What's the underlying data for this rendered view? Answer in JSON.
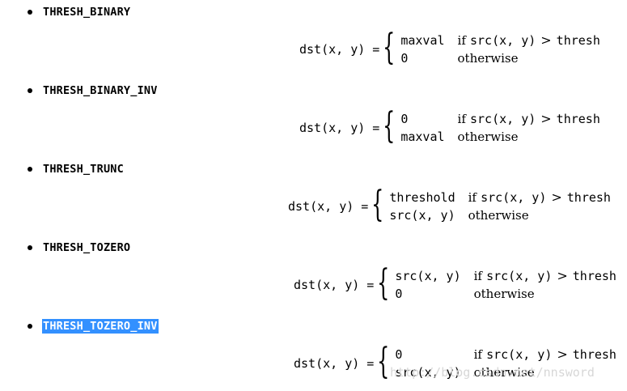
{
  "items": [
    {
      "name": "THRESH_BINARY",
      "selected": false,
      "lhs": "dst(x, y) =",
      "cases": [
        {
          "value": "maxval",
          "condition_prefix": "if",
          "condition": "src(x, y)",
          "op": ">",
          "rhs": "thresh"
        },
        {
          "value": "0",
          "condition_prefix": "",
          "condition": "otherwise",
          "op": "",
          "rhs": ""
        }
      ]
    },
    {
      "name": "THRESH_BINARY_INV",
      "selected": false,
      "lhs": "dst(x, y) =",
      "cases": [
        {
          "value": "0",
          "condition_prefix": "if",
          "condition": "src(x, y)",
          "op": ">",
          "rhs": "thresh"
        },
        {
          "value": "maxval",
          "condition_prefix": "",
          "condition": "otherwise",
          "op": "",
          "rhs": ""
        }
      ]
    },
    {
      "name": "THRESH_TRUNC",
      "selected": false,
      "lhs": "dst(x, y) =",
      "cases": [
        {
          "value": "threshold",
          "condition_prefix": "if",
          "condition": "src(x, y)",
          "op": ">",
          "rhs": "thresh"
        },
        {
          "value": "src(x, y)",
          "condition_prefix": "",
          "condition": "otherwise",
          "op": "",
          "rhs": ""
        }
      ]
    },
    {
      "name": "THRESH_TOZERO",
      "selected": false,
      "lhs": "dst(x, y) =",
      "cases": [
        {
          "value": "src(x, y)",
          "condition_prefix": "if",
          "condition": "src(x, y)",
          "op": ">",
          "rhs": "thresh"
        },
        {
          "value": "0",
          "condition_prefix": "",
          "condition": "otherwise",
          "op": "",
          "rhs": ""
        }
      ]
    },
    {
      "name": "THRESH_TOZERO_INV",
      "selected": true,
      "lhs": "dst(x, y) =",
      "cases": [
        {
          "value": "0",
          "condition_prefix": "if",
          "condition": "src(x, y)",
          "op": ">",
          "rhs": "thresh"
        },
        {
          "value": "src(x, y)",
          "condition_prefix": "",
          "condition": "otherwise",
          "op": "",
          "rhs": ""
        }
      ]
    }
  ],
  "watermark": "http://blog.csdn.net/nnsword",
  "colors": {
    "selection": "#3390ff",
    "selection_text": "#ffffff",
    "watermark": "#d7d7d7"
  }
}
